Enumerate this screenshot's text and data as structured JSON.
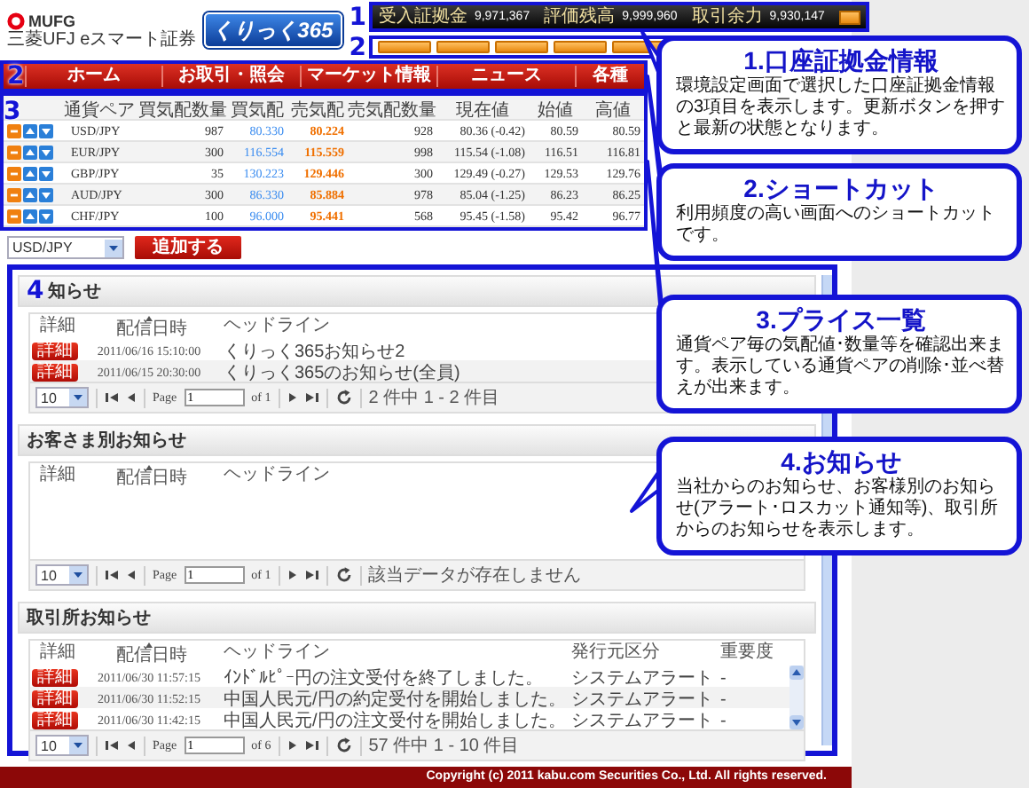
{
  "header": {
    "brand": "MUFG",
    "company": "三菱UFJ eスマート証券",
    "product_logo": "くりっく365",
    "account_marker": "1",
    "shortcut_marker": "2",
    "account": [
      {
        "label": "受入証拠金",
        "value": "9,971,367"
      },
      {
        "label": "評価残高",
        "value": "9,999,960"
      },
      {
        "label": "取引余力",
        "value": "9,930,147"
      }
    ]
  },
  "nav": {
    "marker": "2",
    "items": [
      {
        "label": "ホーム"
      },
      {
        "label": "お取引・照会"
      },
      {
        "label": "マーケット情報"
      },
      {
        "label": "ニュース"
      },
      {
        "label": "各種"
      }
    ]
  },
  "prices": {
    "marker": "3",
    "columns": [
      "通貨ペア",
      "買気配数量",
      "買気配",
      "売気配",
      "売気配数量",
      "現在値",
      "始値",
      "高値"
    ],
    "rows": [
      {
        "cells": [
          "USD/JPY",
          "987",
          "80.330",
          "80.224",
          "928",
          "80.36 (-0.42)",
          "80.59",
          "80.59"
        ]
      },
      {
        "cells": [
          "EUR/JPY",
          "300",
          "116.554",
          "115.559",
          "998",
          "115.54 (-1.08)",
          "116.51",
          "116.81"
        ]
      },
      {
        "cells": [
          "GBP/JPY",
          "35",
          "130.223",
          "129.446",
          "300",
          "129.49 (-0.27)",
          "129.53",
          "129.76"
        ]
      },
      {
        "cells": [
          "AUD/JPY",
          "300",
          "86.330",
          "85.884",
          "978",
          "85.04 (-1.25)",
          "86.23",
          "86.25"
        ]
      },
      {
        "cells": [
          "CHF/JPY",
          "100",
          "96.000",
          "95.441",
          "568",
          "95.45 (-1.58)",
          "95.42",
          "96.77"
        ]
      }
    ]
  },
  "add": {
    "select": "USD/JPY",
    "button": "追加する"
  },
  "news": {
    "marker": "4",
    "sections": [
      {
        "title": "知らせ",
        "columns": [
          "詳細",
          "配信日時",
          "ヘッドライン"
        ],
        "rows": [
          {
            "button": "詳細",
            "date": "2011/06/16 15:10:00",
            "headline": "くりっく365お知らせ2"
          },
          {
            "button": "詳細",
            "date": "2011/06/15 20:30:00",
            "headline": "くりっく365のお知らせ(全員)"
          }
        ],
        "pager": {
          "page_size": "10",
          "page_label": "Page",
          "page": "1",
          "of": "of 1",
          "status": "2 件中 1 - 2 件目"
        }
      },
      {
        "title": "お客さま別お知らせ",
        "columns": [
          "詳細",
          "配信日時",
          "ヘッドライン"
        ],
        "pager": {
          "page_size": "10",
          "page_label": "Page",
          "page": "1",
          "of": "of 1",
          "status": "該当データが存在しません"
        }
      },
      {
        "title": "取引所お知らせ",
        "columns": [
          "詳細",
          "配信日時",
          "ヘッドライン",
          "発行元区分",
          "重要度"
        ],
        "rows": [
          {
            "button": "詳細",
            "date": "2011/06/30 11:57:15",
            "headline": "ｲﾝﾄﾞﾙﾋﾟｰ円の注文受付を終了しました。",
            "source": "システムアラート",
            "importance": "-"
          },
          {
            "button": "詳細",
            "date": "2011/06/30 11:52:15",
            "headline": "中国人民元/円の約定受付を開始しました。",
            "source": "システムアラート",
            "importance": "-"
          },
          {
            "button": "詳細",
            "date": "2011/06/30 11:42:15",
            "headline": "中国人民元/円の注文受付を開始しました。",
            "source": "システムアラート",
            "importance": "-"
          }
        ],
        "pager": {
          "page_size": "10",
          "page_label": "Page",
          "page": "1",
          "of": "of 6",
          "status": "57 件中 1 - 10 件目"
        }
      }
    ]
  },
  "footer": "Copyright (c) 2011 kabu.com Securities Co., Ltd. All rights reserved.",
  "callouts": [
    {
      "title": "1.口座証拠金情報",
      "text": "環境設定画面で選択した口座証拠金情報の3項目を表示します。更新ボタンを押すと最新の状態となります。"
    },
    {
      "title": "2.ショートカット",
      "text": "利用頻度の高い画面へのショートカットです。"
    },
    {
      "title": "3.プライス一覧",
      "text": "通貨ペア毎の気配値･数量等を確認出来ます。表示している通貨ペアの削除･並べ替えが出来ます。"
    },
    {
      "title": "4.お知らせ",
      "text": "当社からのお知らせ、お客様別のお知らせ(アラート･ロスカット通知等)、取引所からのお知らせを表示します。"
    }
  ]
}
